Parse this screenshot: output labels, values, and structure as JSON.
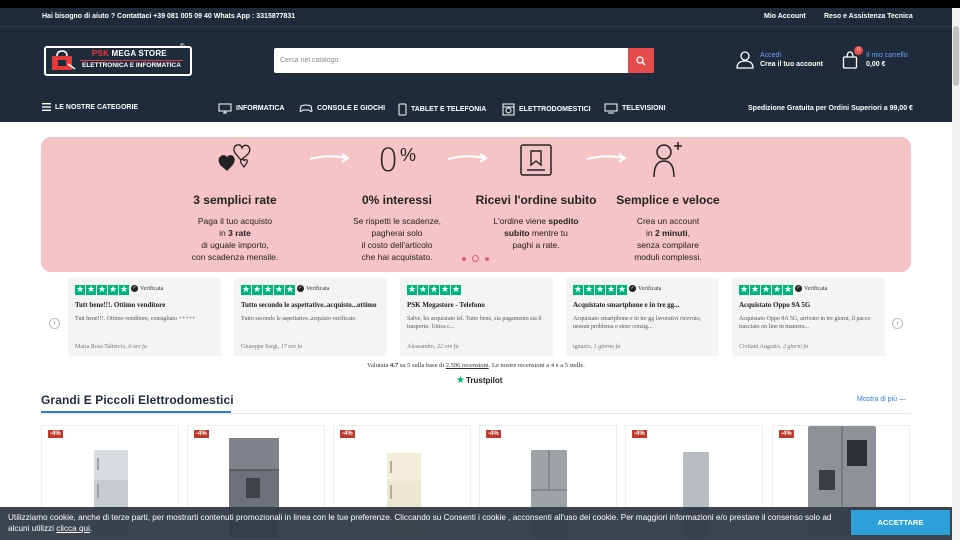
{
  "topbar": {
    "help": "Hai bisogno di aiuto ? Contattaci +39 081 005 09 40 Whats App : 3315877831",
    "account_link": "Mio Account",
    "returns_link": "Reso e Assistenza Tecnica"
  },
  "logo": {
    "brand_red": "PSK",
    "brand_white": "MEGA STORE",
    "registered": "®",
    "tagline": "ELETTRONICA E INFORMATICA"
  },
  "search": {
    "placeholder": "Cerca nel catalogo"
  },
  "account": {
    "login": "Accedi",
    "create": "Crea il tuo account"
  },
  "cart": {
    "count": "0",
    "label": "Il mio carrello",
    "total": "0,00 €"
  },
  "nav": {
    "categories": "LE NOSTRE CATEGORIE",
    "items": [
      "INFORMATICA",
      "CONSOLE E GIOCHI",
      "TABLET E TELEFONIA",
      "ELETTRODOMESTICI",
      "TELEVISIONI"
    ],
    "shipping": "Spedizione Gratuita per Ordini Superiori a 99,00 €"
  },
  "banner": {
    "features": [
      {
        "title": "3 semplici rate",
        "line1": "Paga il tuo acquisto",
        "line2_pre": "in ",
        "line2_bold": "3 rate",
        "line3": "di uguale importo,",
        "line4": "con scadenza mensile."
      },
      {
        "title": "0% interessi",
        "line1": "Se rispetti le scadenze,",
        "line2": "pagherai solo",
        "line3": "il costo dell'articolo",
        "line4": "che hai acquistato."
      },
      {
        "title": "Ricevi l'ordine subito",
        "line1_pre": "L'ordine viene ",
        "line1_bold": "spedito",
        "line2_bold": "subito",
        "line2_post": " mentre tu",
        "line3": "paghi a rate."
      },
      {
        "title": "Semplice e veloce",
        "line1": "Crea un account",
        "line2_pre": "in ",
        "line2_bold": "2 minuti",
        "line2_post": ",",
        "line3": "senza compilare",
        "line4": "moduli complessi."
      }
    ],
    "percent_symbol": "%",
    "zero_symbol": "0"
  },
  "reviews": {
    "verified_label": "Verificata",
    "items": [
      {
        "title": "Tutt bene!!!. Ottimo venditore",
        "text": "Tutt bene!!!. Ottimo venditore, consigliato +++++",
        "author": "Maria Rosa Taliercio,",
        "when": "6 ore fa",
        "verified": true
      },
      {
        "title": "Tutto secondo le aspettative..acquisto...ottimo",
        "text": "Tutto secondo le aspettative..acquisto verificato",
        "author": "Giuseppe Sergi,",
        "when": "17 ore fa",
        "verified": true
      },
      {
        "title": "PSK Megastore - Telefono",
        "text": "Salve, ho acquistato tel. Tutto bene, sia pagamento sia il trasporto. Unica c...",
        "author": "Alessandro,",
        "when": "22 ore fa",
        "verified": false
      },
      {
        "title": "Acquistato smartphone e in tre gg...",
        "text": "Acquistato smartphone e in tre gg lavorativi ricevuto, nessun problema e store consig...",
        "author": "ignazio,",
        "when": "1 giorno fa",
        "verified": true
      },
      {
        "title": "Acquistato Oppo 9A 5G",
        "text": "Acquistato Oppo 9A 5G, arrivato in tre giorni, il pacco tracciato on line in maniera...",
        "author": "Civitani Augusto,",
        "when": "2 giorni fa",
        "verified": true
      }
    ],
    "summary_pre": "Valutata ",
    "summary_rating": "4.7",
    "summary_mid": " su 5 sulla base di ",
    "summary_count": "2.596 recensioni",
    "summary_post": ". Le nostre recensioni a 4 e a 5 stelle.",
    "trustpilot": "Trustpilot"
  },
  "section": {
    "title": "Grandi E Piccoli Elettrodomestici",
    "more": "Mostra di più",
    "products": [
      {
        "discount": "-4%"
      },
      {
        "discount": "-4%"
      },
      {
        "discount": "-4%"
      },
      {
        "discount": "-4%"
      },
      {
        "discount": "-4%"
      },
      {
        "discount": "-4%"
      }
    ]
  },
  "cookie": {
    "text": "Utilizziamo cookie, anche di terze parti, per mostrarti contenuti promozionali in linea con le tue preferenze. Cliccando su Consenti i cookie , acconsenti all'uso dei cookie. Per maggiori informazioni e/o prestare il consenso solo ad alcuni utilizzi ",
    "link": "clicca qui",
    "after": ".",
    "accept": "ACCETTARE"
  },
  "colors": {
    "header": "#1f2b3b",
    "accent_red": "#e74c4c",
    "link_blue": "#2b7de0",
    "banner_pink": "#f6c3c8",
    "trustpilot_green": "#00b67a"
  },
  "icons": [
    "user-icon",
    "cart-icon",
    "search-icon",
    "menu-icon",
    "monitor-icon",
    "gamepad-icon",
    "phone-icon",
    "appliance-icon",
    "tv-icon"
  ]
}
